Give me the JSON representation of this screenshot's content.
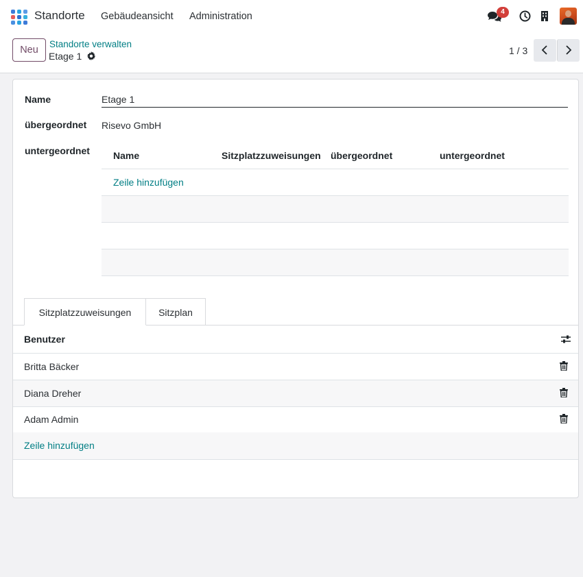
{
  "navbar": {
    "brand": "Standorte",
    "links": [
      "Gebäudeansicht",
      "Administration"
    ],
    "notification_count": "4"
  },
  "control_panel": {
    "new_button": "Neu",
    "breadcrumb_parent": "Standorte verwalten",
    "breadcrumb_current": "Etage 1",
    "pager": "1 / 3"
  },
  "form": {
    "name_label": "Name",
    "name_value": "Etage 1",
    "parent_label": "übergeordnet",
    "parent_value": "Risevo GmbH",
    "children_label": "untergeordnet",
    "children_table": {
      "columns": [
        "Name",
        "Sitzplatzzuweisungen",
        "übergeordnet",
        "untergeordnet"
      ],
      "add_line": "Zeile hinzufügen"
    }
  },
  "tabs": [
    "Sitzplatzzuweisungen",
    "Sitzplan"
  ],
  "users": {
    "header": "Benutzer",
    "rows": [
      "Britta Bäcker",
      "Diana Dreher",
      "Adam Admin"
    ],
    "add_line": "Zeile hinzufügen"
  },
  "colors": {
    "primary": "#714b67",
    "link": "#017e84",
    "badge": "#d23f3a"
  }
}
